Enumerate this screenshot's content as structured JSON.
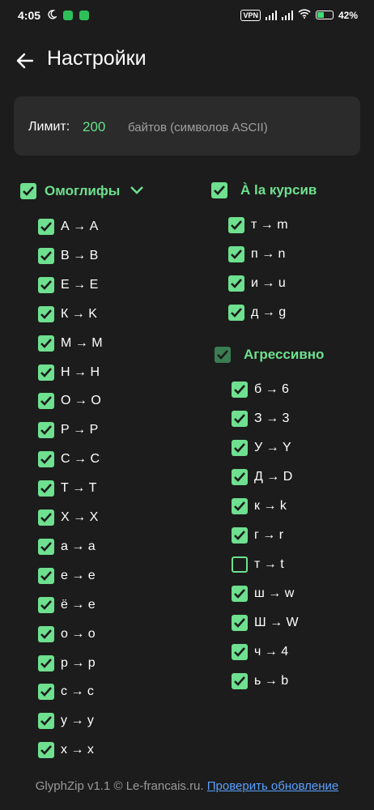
{
  "status_bar": {
    "time": "4:05",
    "vpn": "VPN",
    "battery": "42%"
  },
  "header": {
    "title": "Настройки"
  },
  "limit": {
    "label": "Лимит:",
    "value": "200",
    "unit": "байтов (символов ASCII)"
  },
  "homoglyphs": {
    "title": "Омоглифы",
    "checked": true,
    "items": [
      {
        "label": "А → A",
        "checked": true
      },
      {
        "label": "В → B",
        "checked": true
      },
      {
        "label": "Е → E",
        "checked": true
      },
      {
        "label": "К → K",
        "checked": true
      },
      {
        "label": "М → M",
        "checked": true
      },
      {
        "label": "Н → H",
        "checked": true
      },
      {
        "label": "О → O",
        "checked": true
      },
      {
        "label": "Р → P",
        "checked": true
      },
      {
        "label": "С → C",
        "checked": true
      },
      {
        "label": "Т → T",
        "checked": true
      },
      {
        "label": "Х → X",
        "checked": true
      },
      {
        "label": "а → a",
        "checked": true
      },
      {
        "label": "е → e",
        "checked": true
      },
      {
        "label": "ё → e",
        "checked": true
      },
      {
        "label": "о → o",
        "checked": true
      },
      {
        "label": "р → p",
        "checked": true
      },
      {
        "label": "с → c",
        "checked": true
      },
      {
        "label": "у → y",
        "checked": true
      },
      {
        "label": "х → x",
        "checked": true
      }
    ]
  },
  "cursive": {
    "title": "À la курсив",
    "checked": true,
    "items": [
      {
        "label": "т → m",
        "checked": true
      },
      {
        "label": "п → n",
        "checked": true
      },
      {
        "label": "и → u",
        "checked": true
      },
      {
        "label": "д → g",
        "checked": true
      }
    ]
  },
  "aggressive": {
    "title": "Агрессивно",
    "checked": true,
    "items": [
      {
        "label": "б → 6",
        "checked": true
      },
      {
        "label": "З → 3",
        "checked": true
      },
      {
        "label": "У → Y",
        "checked": true
      },
      {
        "label": "Д → D",
        "checked": true
      },
      {
        "label": "к → k",
        "checked": true
      },
      {
        "label": "г → r",
        "checked": true
      },
      {
        "label": "т → t",
        "checked": false
      },
      {
        "label": "ш → w",
        "checked": true
      },
      {
        "label": "Ш → W",
        "checked": true
      },
      {
        "label": "ч → 4",
        "checked": true
      },
      {
        "label": "ь → b",
        "checked": true
      }
    ]
  },
  "footer": {
    "text": "GlyphZip v1.1 © Le-francais.ru.",
    "link": "Проверить обновление"
  },
  "colors": {
    "accent": "#6ee08f",
    "background": "#1c1c1c",
    "card": "#2b2b2b",
    "link": "#5aa0ff"
  }
}
